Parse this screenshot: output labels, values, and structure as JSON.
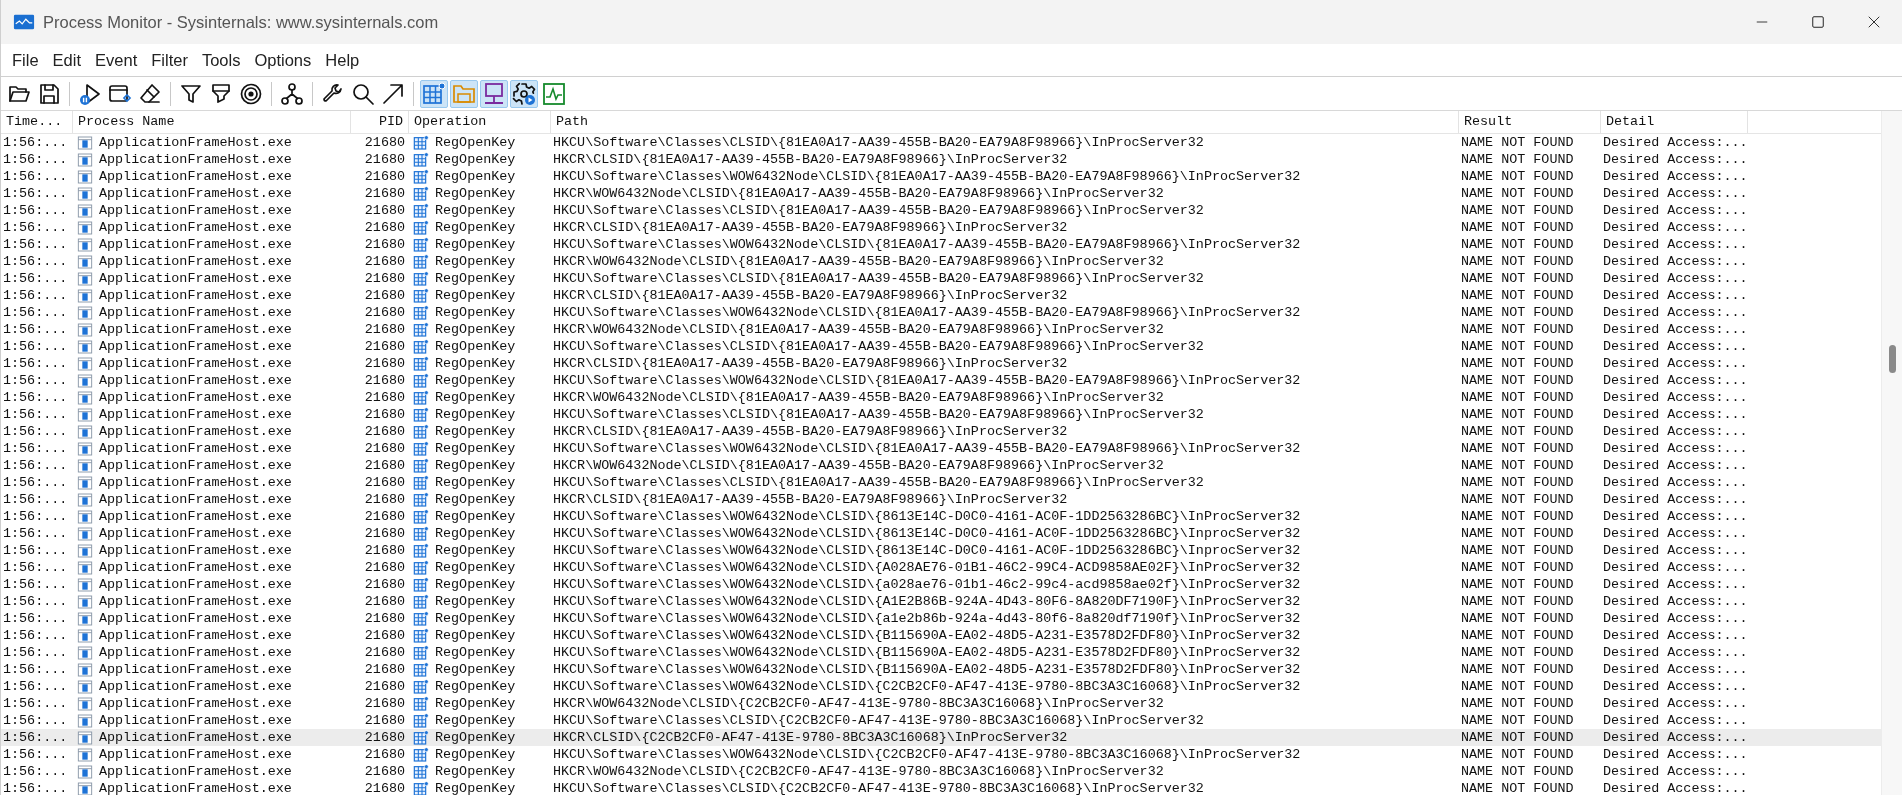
{
  "window": {
    "title": "Process Monitor - Sysinternals: www.sysinternals.com"
  },
  "menu": [
    "File",
    "Edit",
    "Event",
    "Filter",
    "Tools",
    "Options",
    "Help"
  ],
  "toolbar": {
    "event_class_toggles": [
      {
        "on": true
      },
      {
        "on": true
      },
      {
        "on": true
      },
      {
        "on": true
      },
      {
        "on": false
      }
    ]
  },
  "table": {
    "columns": [
      "Time...",
      "Process Name",
      "PID",
      "Operation",
      "Path",
      "Result",
      "Detail"
    ],
    "rows": [
      {
        "time": "1:56:...",
        "process": "ApplicationFrameHost.exe",
        "pid": "21680",
        "operation": "RegOpenKey",
        "path": "HKCU\\Software\\Classes\\CLSID\\{81EA0A17-AA39-455B-BA20-EA79A8F98966}\\InProcServer32",
        "result": "NAME NOT FOUND",
        "detail": "Desired Access:...",
        "selected": false
      },
      {
        "time": "1:56:...",
        "process": "ApplicationFrameHost.exe",
        "pid": "21680",
        "operation": "RegOpenKey",
        "path": "HKCR\\CLSID\\{81EA0A17-AA39-455B-BA20-EA79A8F98966}\\InProcServer32",
        "result": "NAME NOT FOUND",
        "detail": "Desired Access:...",
        "selected": false
      },
      {
        "time": "1:56:...",
        "process": "ApplicationFrameHost.exe",
        "pid": "21680",
        "operation": "RegOpenKey",
        "path": "HKCU\\Software\\Classes\\WOW6432Node\\CLSID\\{81EA0A17-AA39-455B-BA20-EA79A8F98966}\\InProcServer32",
        "result": "NAME NOT FOUND",
        "detail": "Desired Access:...",
        "selected": false
      },
      {
        "time": "1:56:...",
        "process": "ApplicationFrameHost.exe",
        "pid": "21680",
        "operation": "RegOpenKey",
        "path": "HKCR\\WOW6432Node\\CLSID\\{81EA0A17-AA39-455B-BA20-EA79A8F98966}\\InProcServer32",
        "result": "NAME NOT FOUND",
        "detail": "Desired Access:...",
        "selected": false
      },
      {
        "time": "1:56:...",
        "process": "ApplicationFrameHost.exe",
        "pid": "21680",
        "operation": "RegOpenKey",
        "path": "HKCU\\Software\\Classes\\CLSID\\{81EA0A17-AA39-455B-BA20-EA79A8F98966}\\InProcServer32",
        "result": "NAME NOT FOUND",
        "detail": "Desired Access:...",
        "selected": false
      },
      {
        "time": "1:56:...",
        "process": "ApplicationFrameHost.exe",
        "pid": "21680",
        "operation": "RegOpenKey",
        "path": "HKCR\\CLSID\\{81EA0A17-AA39-455B-BA20-EA79A8F98966}\\InProcServer32",
        "result": "NAME NOT FOUND",
        "detail": "Desired Access:...",
        "selected": false
      },
      {
        "time": "1:56:...",
        "process": "ApplicationFrameHost.exe",
        "pid": "21680",
        "operation": "RegOpenKey",
        "path": "HKCU\\Software\\Classes\\WOW6432Node\\CLSID\\{81EA0A17-AA39-455B-BA20-EA79A8F98966}\\InProcServer32",
        "result": "NAME NOT FOUND",
        "detail": "Desired Access:...",
        "selected": false
      },
      {
        "time": "1:56:...",
        "process": "ApplicationFrameHost.exe",
        "pid": "21680",
        "operation": "RegOpenKey",
        "path": "HKCR\\WOW6432Node\\CLSID\\{81EA0A17-AA39-455B-BA20-EA79A8F98966}\\InProcServer32",
        "result": "NAME NOT FOUND",
        "detail": "Desired Access:...",
        "selected": false
      },
      {
        "time": "1:56:...",
        "process": "ApplicationFrameHost.exe",
        "pid": "21680",
        "operation": "RegOpenKey",
        "path": "HKCU\\Software\\Classes\\CLSID\\{81EA0A17-AA39-455B-BA20-EA79A8F98966}\\InProcServer32",
        "result": "NAME NOT FOUND",
        "detail": "Desired Access:...",
        "selected": false
      },
      {
        "time": "1:56:...",
        "process": "ApplicationFrameHost.exe",
        "pid": "21680",
        "operation": "RegOpenKey",
        "path": "HKCR\\CLSID\\{81EA0A17-AA39-455B-BA20-EA79A8F98966}\\InProcServer32",
        "result": "NAME NOT FOUND",
        "detail": "Desired Access:...",
        "selected": false
      },
      {
        "time": "1:56:...",
        "process": "ApplicationFrameHost.exe",
        "pid": "21680",
        "operation": "RegOpenKey",
        "path": "HKCU\\Software\\Classes\\WOW6432Node\\CLSID\\{81EA0A17-AA39-455B-BA20-EA79A8F98966}\\InProcServer32",
        "result": "NAME NOT FOUND",
        "detail": "Desired Access:...",
        "selected": false
      },
      {
        "time": "1:56:...",
        "process": "ApplicationFrameHost.exe",
        "pid": "21680",
        "operation": "RegOpenKey",
        "path": "HKCR\\WOW6432Node\\CLSID\\{81EA0A17-AA39-455B-BA20-EA79A8F98966}\\InProcServer32",
        "result": "NAME NOT FOUND",
        "detail": "Desired Access:...",
        "selected": false
      },
      {
        "time": "1:56:...",
        "process": "ApplicationFrameHost.exe",
        "pid": "21680",
        "operation": "RegOpenKey",
        "path": "HKCU\\Software\\Classes\\CLSID\\{81EA0A17-AA39-455B-BA20-EA79A8F98966}\\InProcServer32",
        "result": "NAME NOT FOUND",
        "detail": "Desired Access:...",
        "selected": false
      },
      {
        "time": "1:56:...",
        "process": "ApplicationFrameHost.exe",
        "pid": "21680",
        "operation": "RegOpenKey",
        "path": "HKCR\\CLSID\\{81EA0A17-AA39-455B-BA20-EA79A8F98966}\\InProcServer32",
        "result": "NAME NOT FOUND",
        "detail": "Desired Access:...",
        "selected": false
      },
      {
        "time": "1:56:...",
        "process": "ApplicationFrameHost.exe",
        "pid": "21680",
        "operation": "RegOpenKey",
        "path": "HKCU\\Software\\Classes\\WOW6432Node\\CLSID\\{81EA0A17-AA39-455B-BA20-EA79A8F98966}\\InProcServer32",
        "result": "NAME NOT FOUND",
        "detail": "Desired Access:...",
        "selected": false
      },
      {
        "time": "1:56:...",
        "process": "ApplicationFrameHost.exe",
        "pid": "21680",
        "operation": "RegOpenKey",
        "path": "HKCR\\WOW6432Node\\CLSID\\{81EA0A17-AA39-455B-BA20-EA79A8F98966}\\InProcServer32",
        "result": "NAME NOT FOUND",
        "detail": "Desired Access:...",
        "selected": false
      },
      {
        "time": "1:56:...",
        "process": "ApplicationFrameHost.exe",
        "pid": "21680",
        "operation": "RegOpenKey",
        "path": "HKCU\\Software\\Classes\\CLSID\\{81EA0A17-AA39-455B-BA20-EA79A8F98966}\\InProcServer32",
        "result": "NAME NOT FOUND",
        "detail": "Desired Access:...",
        "selected": false
      },
      {
        "time": "1:56:...",
        "process": "ApplicationFrameHost.exe",
        "pid": "21680",
        "operation": "RegOpenKey",
        "path": "HKCR\\CLSID\\{81EA0A17-AA39-455B-BA20-EA79A8F98966}\\InProcServer32",
        "result": "NAME NOT FOUND",
        "detail": "Desired Access:...",
        "selected": false
      },
      {
        "time": "1:56:...",
        "process": "ApplicationFrameHost.exe",
        "pid": "21680",
        "operation": "RegOpenKey",
        "path": "HKCU\\Software\\Classes\\WOW6432Node\\CLSID\\{81EA0A17-AA39-455B-BA20-EA79A8F98966}\\InProcServer32",
        "result": "NAME NOT FOUND",
        "detail": "Desired Access:...",
        "selected": false
      },
      {
        "time": "1:56:...",
        "process": "ApplicationFrameHost.exe",
        "pid": "21680",
        "operation": "RegOpenKey",
        "path": "HKCR\\WOW6432Node\\CLSID\\{81EA0A17-AA39-455B-BA20-EA79A8F98966}\\InProcServer32",
        "result": "NAME NOT FOUND",
        "detail": "Desired Access:...",
        "selected": false
      },
      {
        "time": "1:56:...",
        "process": "ApplicationFrameHost.exe",
        "pid": "21680",
        "operation": "RegOpenKey",
        "path": "HKCU\\Software\\Classes\\CLSID\\{81EA0A17-AA39-455B-BA20-EA79A8F98966}\\InProcServer32",
        "result": "NAME NOT FOUND",
        "detail": "Desired Access:...",
        "selected": false
      },
      {
        "time": "1:56:...",
        "process": "ApplicationFrameHost.exe",
        "pid": "21680",
        "operation": "RegOpenKey",
        "path": "HKCR\\CLSID\\{81EA0A17-AA39-455B-BA20-EA79A8F98966}\\InProcServer32",
        "result": "NAME NOT FOUND",
        "detail": "Desired Access:...",
        "selected": false
      },
      {
        "time": "1:56:...",
        "process": "ApplicationFrameHost.exe",
        "pid": "21680",
        "operation": "RegOpenKey",
        "path": "HKCU\\Software\\Classes\\WOW6432Node\\CLSID\\{8613E14C-D0C0-4161-AC0F-1DD2563286BC}\\InProcServer32",
        "result": "NAME NOT FOUND",
        "detail": "Desired Access:...",
        "selected": false
      },
      {
        "time": "1:56:...",
        "process": "ApplicationFrameHost.exe",
        "pid": "21680",
        "operation": "RegOpenKey",
        "path": "HKCU\\Software\\Classes\\WOW6432Node\\CLSID\\{8613E14C-D0C0-4161-AC0F-1DD2563286BC}\\InprocServer32",
        "result": "NAME NOT FOUND",
        "detail": "Desired Access:...",
        "selected": false
      },
      {
        "time": "1:56:...",
        "process": "ApplicationFrameHost.exe",
        "pid": "21680",
        "operation": "RegOpenKey",
        "path": "HKCU\\Software\\Classes\\WOW6432Node\\CLSID\\{8613E14C-D0C0-4161-AC0F-1DD2563286BC}\\InprocServer32",
        "result": "NAME NOT FOUND",
        "detail": "Desired Access:...",
        "selected": false
      },
      {
        "time": "1:56:...",
        "process": "ApplicationFrameHost.exe",
        "pid": "21680",
        "operation": "RegOpenKey",
        "path": "HKCU\\Software\\Classes\\WOW6432Node\\CLSID\\{A028AE76-01B1-46C2-99C4-ACD9858AE02F}\\InProcServer32",
        "result": "NAME NOT FOUND",
        "detail": "Desired Access:...",
        "selected": false
      },
      {
        "time": "1:56:...",
        "process": "ApplicationFrameHost.exe",
        "pid": "21680",
        "operation": "RegOpenKey",
        "path": "HKCU\\Software\\Classes\\WOW6432Node\\CLSID\\{a028ae76-01b1-46c2-99c4-acd9858ae02f}\\InProcServer32",
        "result": "NAME NOT FOUND",
        "detail": "Desired Access:...",
        "selected": false
      },
      {
        "time": "1:56:...",
        "process": "ApplicationFrameHost.exe",
        "pid": "21680",
        "operation": "RegOpenKey",
        "path": "HKCU\\Software\\Classes\\WOW6432Node\\CLSID\\{A1E2B86B-924A-4D43-80F6-8A820DF7190F}\\InProcServer32",
        "result": "NAME NOT FOUND",
        "detail": "Desired Access:...",
        "selected": false
      },
      {
        "time": "1:56:...",
        "process": "ApplicationFrameHost.exe",
        "pid": "21680",
        "operation": "RegOpenKey",
        "path": "HKCU\\Software\\Classes\\WOW6432Node\\CLSID\\{a1e2b86b-924a-4d43-80f6-8a820df7190f}\\InProcServer32",
        "result": "NAME NOT FOUND",
        "detail": "Desired Access:...",
        "selected": false
      },
      {
        "time": "1:56:...",
        "process": "ApplicationFrameHost.exe",
        "pid": "21680",
        "operation": "RegOpenKey",
        "path": "HKCU\\Software\\Classes\\WOW6432Node\\CLSID\\{B115690A-EA02-48D5-A231-E3578D2FDF80}\\InProcServer32",
        "result": "NAME NOT FOUND",
        "detail": "Desired Access:...",
        "selected": false
      },
      {
        "time": "1:56:...",
        "process": "ApplicationFrameHost.exe",
        "pid": "21680",
        "operation": "RegOpenKey",
        "path": "HKCU\\Software\\Classes\\WOW6432Node\\CLSID\\{B115690A-EA02-48D5-A231-E3578D2FDF80}\\InProcServer32",
        "result": "NAME NOT FOUND",
        "detail": "Desired Access:...",
        "selected": false
      },
      {
        "time": "1:56:...",
        "process": "ApplicationFrameHost.exe",
        "pid": "21680",
        "operation": "RegOpenKey",
        "path": "HKCU\\Software\\Classes\\WOW6432Node\\CLSID\\{B115690A-EA02-48D5-A231-E3578D2FDF80}\\InProcServer32",
        "result": "NAME NOT FOUND",
        "detail": "Desired Access:...",
        "selected": false
      },
      {
        "time": "1:56:...",
        "process": "ApplicationFrameHost.exe",
        "pid": "21680",
        "operation": "RegOpenKey",
        "path": "HKCU\\Software\\Classes\\WOW6432Node\\CLSID\\{C2CB2CF0-AF47-413E-9780-8BC3A3C16068}\\InProcServer32",
        "result": "NAME NOT FOUND",
        "detail": "Desired Access:...",
        "selected": false
      },
      {
        "time": "1:56:...",
        "process": "ApplicationFrameHost.exe",
        "pid": "21680",
        "operation": "RegOpenKey",
        "path": "HKCR\\WOW6432Node\\CLSID\\{C2CB2CF0-AF47-413E-9780-8BC3A3C16068}\\InProcServer32",
        "result": "NAME NOT FOUND",
        "detail": "Desired Access:...",
        "selected": false
      },
      {
        "time": "1:56:...",
        "process": "ApplicationFrameHost.exe",
        "pid": "21680",
        "operation": "RegOpenKey",
        "path": "HKCU\\Software\\Classes\\CLSID\\{C2CB2CF0-AF47-413E-9780-8BC3A3C16068}\\InProcServer32",
        "result": "NAME NOT FOUND",
        "detail": "Desired Access:...",
        "selected": false
      },
      {
        "time": "1:56:...",
        "process": "ApplicationFrameHost.exe",
        "pid": "21680",
        "operation": "RegOpenKey",
        "path": "HKCR\\CLSID\\{C2CB2CF0-AF47-413E-9780-8BC3A3C16068}\\InProcServer32",
        "result": "NAME NOT FOUND",
        "detail": "Desired Access:...",
        "selected": true
      },
      {
        "time": "1:56:...",
        "process": "ApplicationFrameHost.exe",
        "pid": "21680",
        "operation": "RegOpenKey",
        "path": "HKCU\\Software\\Classes\\WOW6432Node\\CLSID\\{C2CB2CF0-AF47-413E-9780-8BC3A3C16068}\\InProcServer32",
        "result": "NAME NOT FOUND",
        "detail": "Desired Access:...",
        "selected": false
      },
      {
        "time": "1:56:...",
        "process": "ApplicationFrameHost.exe",
        "pid": "21680",
        "operation": "RegOpenKey",
        "path": "HKCR\\WOW6432Node\\CLSID\\{C2CB2CF0-AF47-413E-9780-8BC3A3C16068}\\InProcServer32",
        "result": "NAME NOT FOUND",
        "detail": "Desired Access:...",
        "selected": false
      },
      {
        "time": "1:56:...",
        "process": "ApplicationFrameHost.exe",
        "pid": "21680",
        "operation": "RegOpenKey",
        "path": "HKCU\\Software\\Classes\\CLSID\\{C2CB2CF0-AF47-413E-9780-8BC3A3C16068}\\InProcServer32",
        "result": "NAME NOT FOUND",
        "detail": "Desired Access:...",
        "selected": false
      }
    ]
  }
}
